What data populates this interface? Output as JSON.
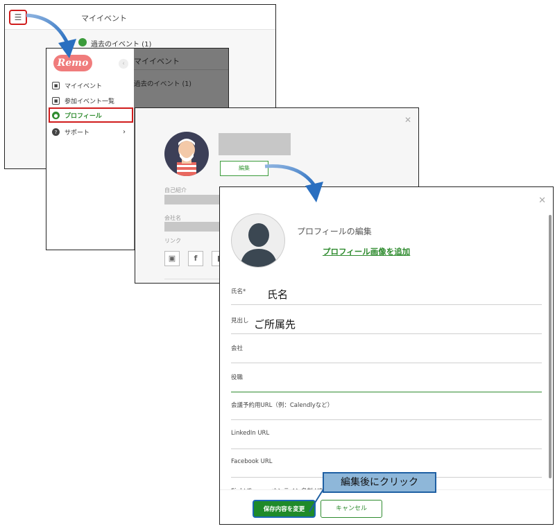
{
  "window_my_events": {
    "title": "マイイベント",
    "past_events": "過去のイベント (1)",
    "menu_icon": "hamburger-icon"
  },
  "sidebar": {
    "logo": "Remo",
    "items": [
      {
        "label": "マイイベント",
        "icon": "calendar-icon"
      },
      {
        "label": "参加イベント一覧",
        "icon": "calendar-check-icon"
      },
      {
        "label": "プロフィール",
        "icon": "user-circle-icon"
      },
      {
        "label": "サポート",
        "icon": "help-icon",
        "chevron": "›"
      }
    ],
    "dim_title": "マイイベント",
    "dim_past": "過去のイベント (1)"
  },
  "profile_view": {
    "edit_button": "編集",
    "labels": {
      "bio": "自己紹介",
      "company": "会社名",
      "links": "リンク"
    }
  },
  "profile_edit": {
    "heading": "プロフィールの編集",
    "add_picture": "プロフィール画像を追加",
    "fields": [
      {
        "label": "氏名*",
        "value": "氏名"
      },
      {
        "label": "見出し",
        "value": "ご所属先"
      },
      {
        "label": "会社",
        "value": ""
      },
      {
        "label": "役職",
        "value": ""
      },
      {
        "label": "会議予約用URL（例：Calendlyなど）",
        "value": ""
      },
      {
        "label": "LinkedIn URL",
        "value": ""
      },
      {
        "label": "Facebook URL",
        "value": ""
      },
      {
        "label": "Eight/Sansan オンライン名刺 URL",
        "value": ""
      }
    ],
    "save_button": "保存内容を変更",
    "cancel_button": "キャンセル"
  },
  "callout": "編集後にクリック",
  "colors": {
    "accent_green": "#2e8b2e",
    "highlight_red": "#d01b1b",
    "arrow_blue": "#2a6fc0",
    "callout_bg": "#8eb7d9"
  }
}
